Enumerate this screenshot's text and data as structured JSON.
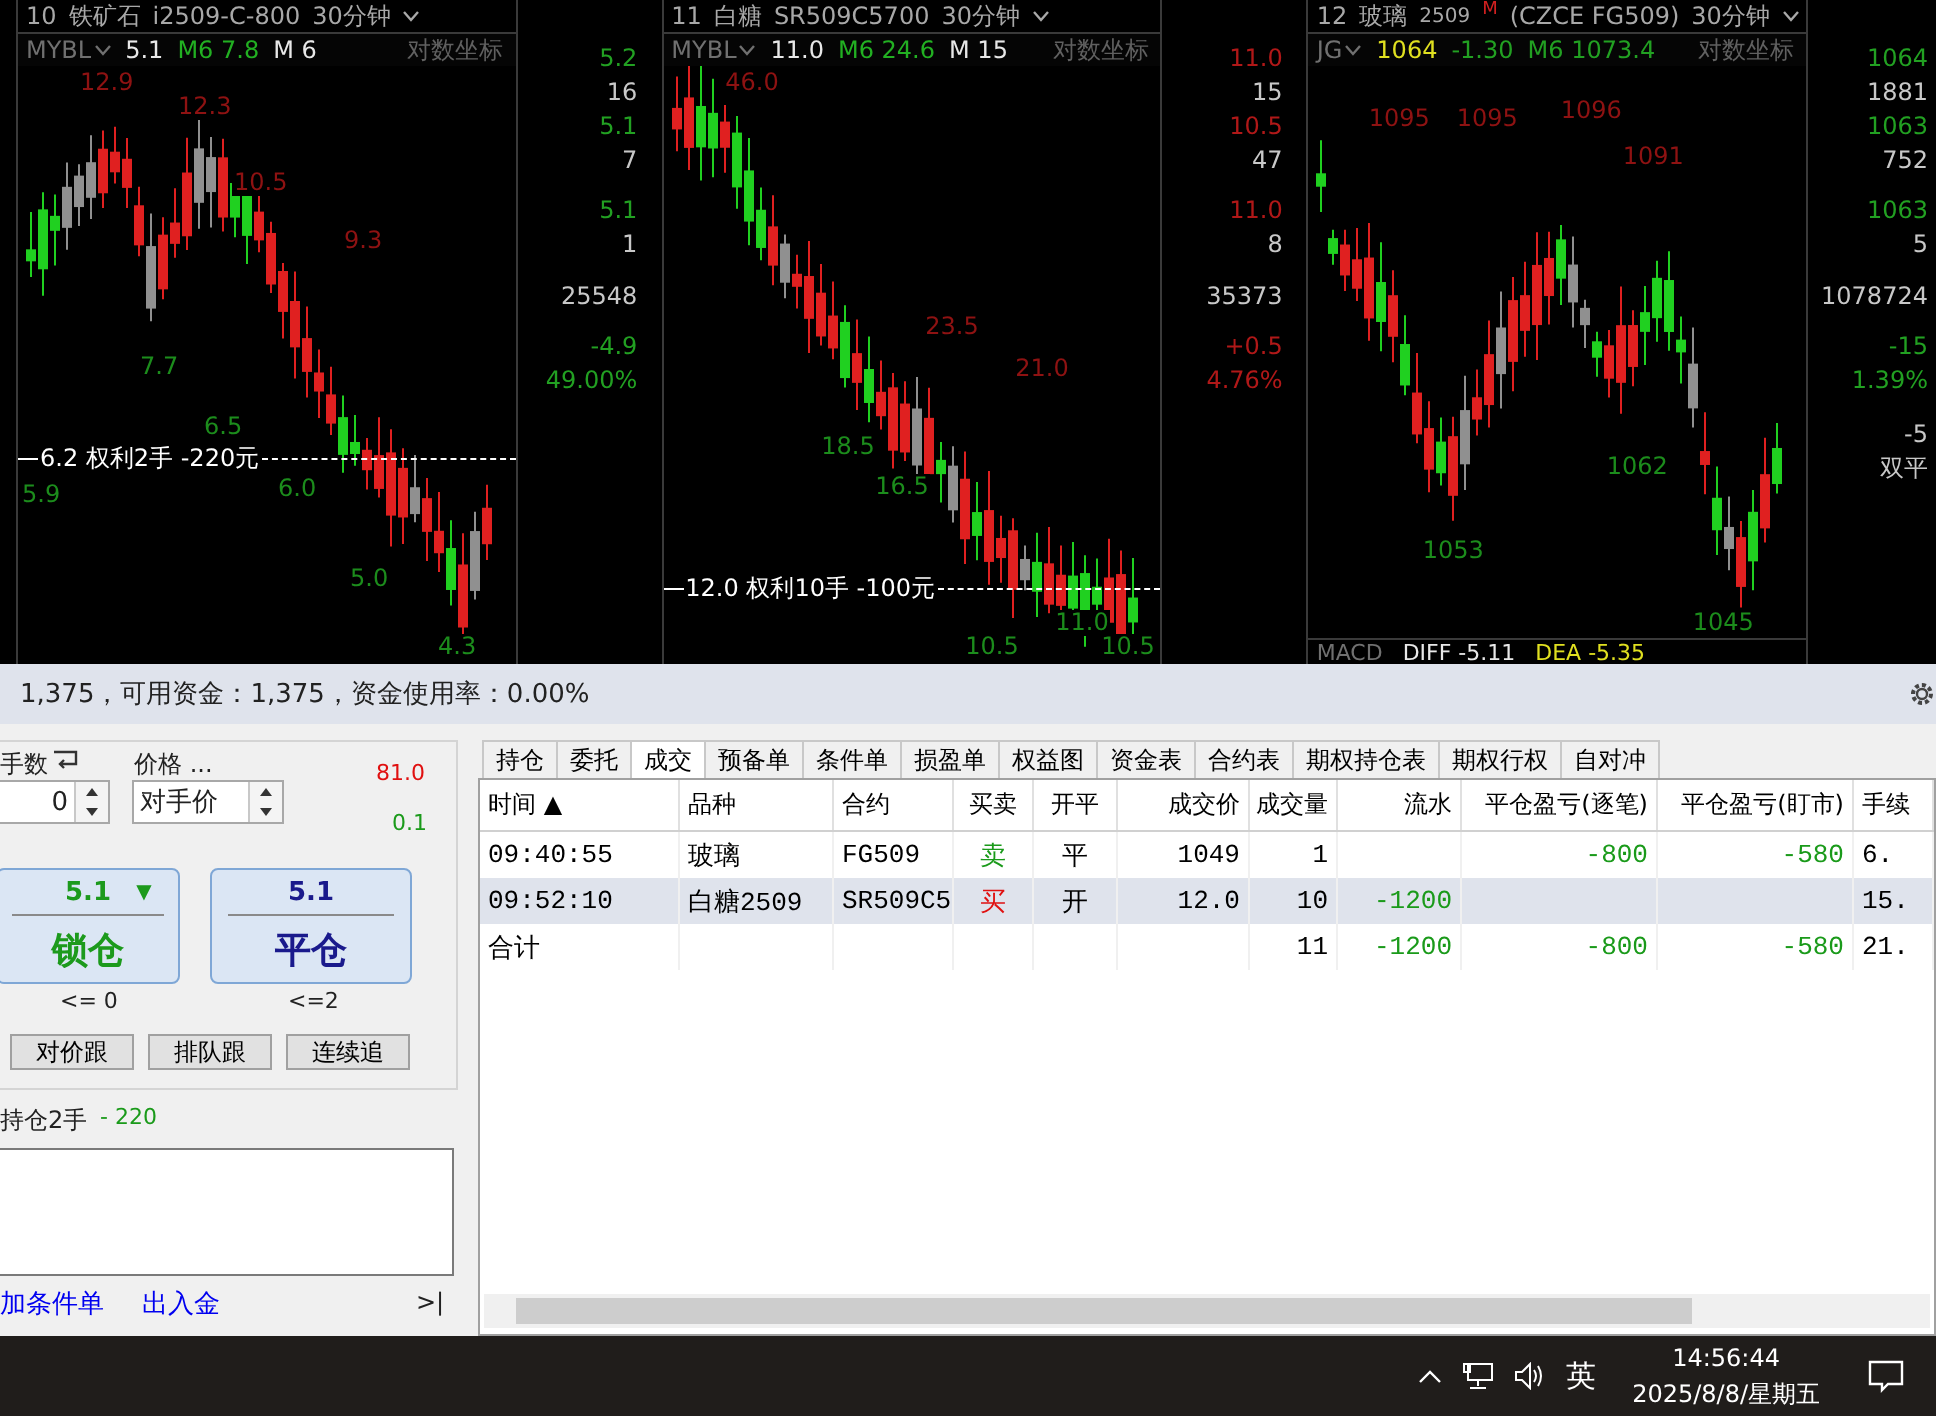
{
  "charts": [
    {
      "number": "10",
      "name": "铁矿石",
      "code": "i2509-C-800",
      "period": "30分钟",
      "indicator": "MYBL",
      "readings": [
        {
          "text": "5.1",
          "color": "#e8e8e8"
        },
        {
          "text": "M6 7.8",
          "color": "#22b022"
        },
        {
          "text": "M 6",
          "color": "#e8e8e8"
        }
      ],
      "scale_label": "对数坐标",
      "price_labels": [
        {
          "text": "12.9",
          "kind": "high"
        },
        {
          "text": "12.3",
          "kind": "high"
        },
        {
          "text": "10.5",
          "kind": "high"
        },
        {
          "text": "9.3",
          "kind": "high"
        },
        {
          "text": "7.7",
          "kind": "low"
        },
        {
          "text": "6.5",
          "kind": "low"
        },
        {
          "text": "5.9",
          "kind": "low"
        },
        {
          "text": "6.0",
          "kind": "low"
        },
        {
          "text": "5.0",
          "kind": "low"
        },
        {
          "text": "4.3",
          "kind": "low"
        }
      ],
      "position_line": "6.2 权利2手 -220元",
      "side_values": [
        {
          "text": "5.2",
          "color": "#22a022"
        },
        {
          "text": "16",
          "color": "#c8c8c8"
        },
        {
          "text": "5.1",
          "color": "#22a022"
        },
        {
          "text": "7",
          "color": "#c8c8c8"
        },
        {
          "text": "5.1",
          "color": "#22a022"
        },
        {
          "text": "1",
          "color": "#c8c8c8"
        },
        {
          "text": "25548",
          "color": "#c8c8c8"
        },
        {
          "text": "-4.9",
          "color": "#22a022"
        },
        {
          "text": "49.00%",
          "color": "#22a022"
        }
      ]
    },
    {
      "number": "11",
      "name": "白糖",
      "code": "SR509C5700",
      "period": "30分钟",
      "indicator": "MYBL",
      "readings": [
        {
          "text": "11.0",
          "color": "#e8e8e8"
        },
        {
          "text": "M6 24.6",
          "color": "#22b022"
        },
        {
          "text": "M 15",
          "color": "#e8e8e8"
        }
      ],
      "scale_label": "对数坐标",
      "price_labels": [
        {
          "text": "46.0",
          "kind": "high"
        },
        {
          "text": "23.5",
          "kind": "high"
        },
        {
          "text": "21.0",
          "kind": "high"
        },
        {
          "text": "18.5",
          "kind": "low"
        },
        {
          "text": "16.5",
          "kind": "low"
        },
        {
          "text": "11.0",
          "kind": "low"
        },
        {
          "text": "10.5",
          "kind": "low"
        },
        {
          "text": "10.5",
          "kind": "low"
        }
      ],
      "position_line": "12.0 权利10手 -100元",
      "side_values": [
        {
          "text": "11.0",
          "color": "#b01818"
        },
        {
          "text": "15",
          "color": "#c8c8c8"
        },
        {
          "text": "10.5",
          "color": "#b01818"
        },
        {
          "text": "47",
          "color": "#c8c8c8"
        },
        {
          "text": "11.0",
          "color": "#b01818"
        },
        {
          "text": "8",
          "color": "#c8c8c8"
        },
        {
          "text": "35373",
          "color": "#c8c8c8"
        },
        {
          "text": "+0.5",
          "color": "#b01818"
        },
        {
          "text": "4.76%",
          "color": "#b01818"
        }
      ]
    },
    {
      "number": "12",
      "name": "玻璃",
      "code": "2509",
      "badge": "M",
      "market": "(CZCE FG509)",
      "period": "30分钟",
      "indicator": "JG",
      "readings": [
        {
          "text": "1064",
          "color": "#e0e020"
        },
        {
          "text": "-1.30",
          "color": "#22a022"
        },
        {
          "text": "M6 1073.4",
          "color": "#22a022"
        }
      ],
      "scale_label": "对数坐标",
      "price_labels": [
        {
          "text": "1095",
          "kind": "high"
        },
        {
          "text": "1095",
          "kind": "high"
        },
        {
          "text": "1096",
          "kind": "high"
        },
        {
          "text": "1091",
          "kind": "high"
        },
        {
          "text": "1062",
          "kind": "low"
        },
        {
          "text": "1053",
          "kind": "low"
        },
        {
          "text": "1045",
          "kind": "low"
        }
      ],
      "side_values": [
        {
          "text": "1064",
          "color": "#22a022"
        },
        {
          "text": "1881",
          "color": "#c8c8c8"
        },
        {
          "text": "1063",
          "color": "#22a022"
        },
        {
          "text": "752",
          "color": "#c8c8c8"
        },
        {
          "text": "1063",
          "color": "#22a022"
        },
        {
          "text": "5",
          "color": "#c8c8c8"
        },
        {
          "text": "1078724",
          "color": "#c8c8c8"
        },
        {
          "text": "-15",
          "color": "#22a022"
        },
        {
          "text": "1.39%",
          "color": "#22a022"
        },
        {
          "text": "-5",
          "color": "#c8c8c8"
        },
        {
          "text": "双平",
          "color": "#c8c8c8"
        }
      ],
      "sub_indicator": {
        "name": "MACD",
        "readings": [
          {
            "text": "DIFF -5.11",
            "color": "#e8e8e8"
          },
          {
            "text": "DEA -5.35",
            "color": "#e0e020"
          }
        ]
      }
    }
  ],
  "account_bar": "1,375，可用资金：1,375，资金使用率：0.00%",
  "order_panel": {
    "qty_label": "手数",
    "qty_value": "0",
    "price_label": "价格 ...",
    "price_value": "对手价",
    "upper_price": "81.0",
    "tick": "0.1",
    "buttons": [
      {
        "kind": "lock",
        "price": "5.1",
        "arrow": "▼",
        "label": "锁仓",
        "limit": "<= 0"
      },
      {
        "kind": "close",
        "price": "5.1",
        "label": "平仓",
        "limit": "<=2"
      }
    ],
    "follow_buttons": [
      "对价跟",
      "排队跟",
      "连续追"
    ],
    "position_text": "持仓2手",
    "position_pnl": "- 220",
    "links": [
      "加条件单",
      "出入金"
    ],
    "expand": ">|"
  },
  "tabs": [
    {
      "label": "持仓",
      "selected": false
    },
    {
      "label": "委托",
      "selected": false
    },
    {
      "label": "成交",
      "selected": true
    },
    {
      "label": "预备单",
      "selected": false
    },
    {
      "label": "条件单",
      "selected": false
    },
    {
      "label": "损盈单",
      "selected": false
    },
    {
      "label": "权益图",
      "selected": false
    },
    {
      "label": "资金表",
      "selected": false
    },
    {
      "label": "合约表",
      "selected": false
    },
    {
      "label": "期权持仓表",
      "selected": false
    },
    {
      "label": "期权行权",
      "selected": false
    },
    {
      "label": "自对冲",
      "selected": false
    }
  ],
  "table": {
    "columns": [
      "时间 ▲",
      "品种",
      "合约",
      "买卖",
      "开平",
      "成交价",
      "成交量",
      "流水",
      "平仓盈亏(逐笔)",
      "平仓盈亏(盯市)",
      "手续"
    ],
    "rows": [
      {
        "selected": false,
        "cells": [
          {
            "text": "09:40:55"
          },
          {
            "text": "玻璃"
          },
          {
            "text": "FG509"
          },
          {
            "text": "卖",
            "color": "#1a9a1a"
          },
          {
            "text": "平"
          },
          {
            "text": "1049"
          },
          {
            "text": "1"
          },
          {
            "text": ""
          },
          {
            "text": "-800",
            "color": "#1a9a1a"
          },
          {
            "text": "-580",
            "color": "#1a9a1a"
          },
          {
            "text": "6."
          }
        ]
      },
      {
        "selected": true,
        "cells": [
          {
            "text": "09:52:10"
          },
          {
            "text": "白糖2509"
          },
          {
            "text": "SR509C5"
          },
          {
            "text": "买",
            "color": "#e01010"
          },
          {
            "text": "开"
          },
          {
            "text": "12.0"
          },
          {
            "text": "10"
          },
          {
            "text": "-1200",
            "color": "#1a9a1a"
          },
          {
            "text": ""
          },
          {
            "text": ""
          },
          {
            "text": "15."
          }
        ]
      },
      {
        "selected": false,
        "cells": [
          {
            "text": "合计"
          },
          {
            "text": ""
          },
          {
            "text": ""
          },
          {
            "text": ""
          },
          {
            "text": ""
          },
          {
            "text": ""
          },
          {
            "text": "11"
          },
          {
            "text": "-1200",
            "color": "#1a9a1a"
          },
          {
            "text": "-800",
            "color": "#1a9a1a"
          },
          {
            "text": "-580",
            "color": "#1a9a1a"
          },
          {
            "text": "21."
          }
        ]
      }
    ]
  },
  "taskbar": {
    "ime": "英",
    "time": "14:56:44",
    "date": "2025/8/8/星期五"
  }
}
